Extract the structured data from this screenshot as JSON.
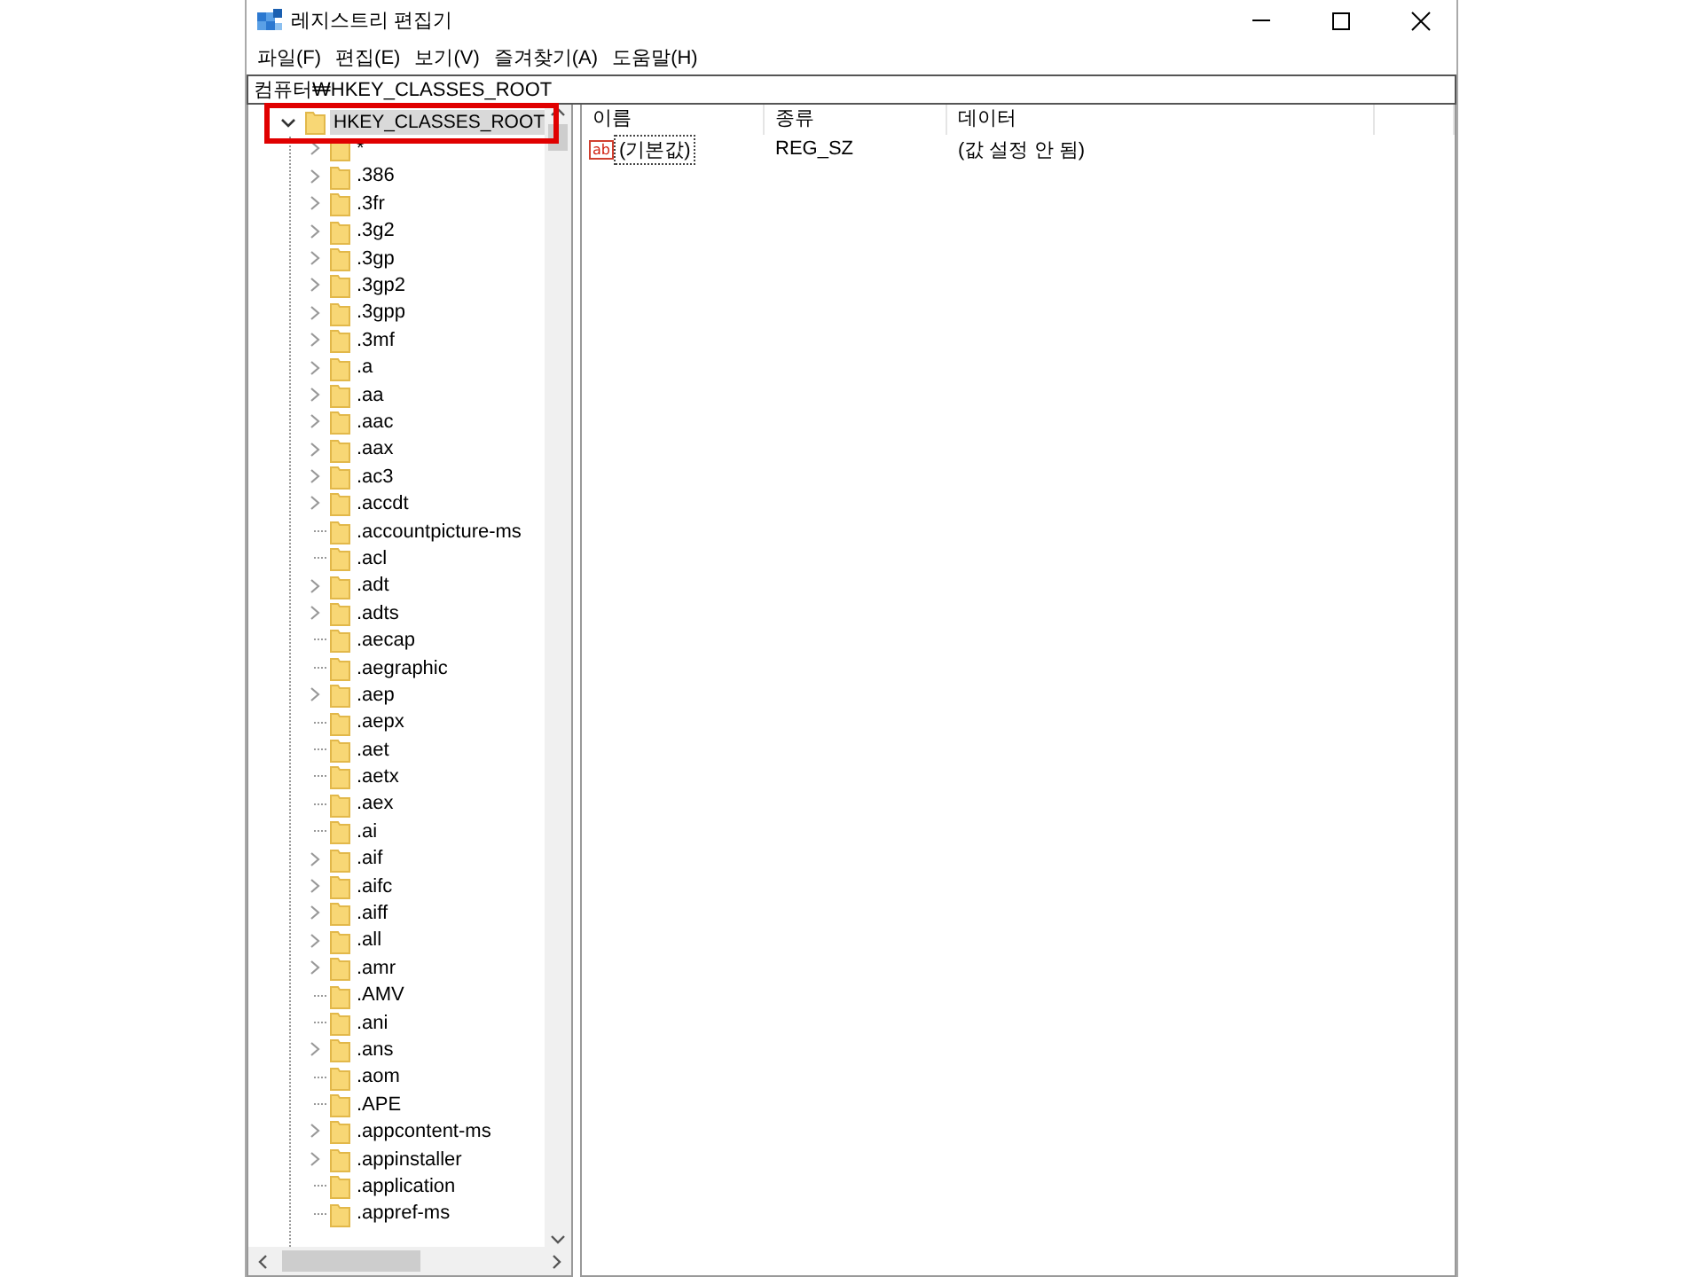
{
  "window": {
    "title": "레지스트리 편집기"
  },
  "menu": [
    "파일(F)",
    "편집(E)",
    "보기(V)",
    "즐겨찾기(A)",
    "도움말(H)"
  ],
  "address": "컴퓨터₩HKEY_CLASSES_ROOT",
  "tree": {
    "label": "HKEY_CLASSES_ROOT",
    "expanded": true,
    "selected": true,
    "outlined": true,
    "children": [
      {
        "label": "*",
        "expandable": true
      },
      {
        "label": ".386",
        "expandable": true
      },
      {
        "label": ".3fr",
        "expandable": true
      },
      {
        "label": ".3g2",
        "expandable": true
      },
      {
        "label": ".3gp",
        "expandable": true
      },
      {
        "label": ".3gp2",
        "expandable": true
      },
      {
        "label": ".3gpp",
        "expandable": true
      },
      {
        "label": ".3mf",
        "expandable": true
      },
      {
        "label": ".a",
        "expandable": true
      },
      {
        "label": ".aa",
        "expandable": true
      },
      {
        "label": ".aac",
        "expandable": true
      },
      {
        "label": ".aax",
        "expandable": true
      },
      {
        "label": ".ac3",
        "expandable": true
      },
      {
        "label": ".accdt",
        "expandable": true
      },
      {
        "label": ".accountpicture-ms",
        "expandable": false
      },
      {
        "label": ".acl",
        "expandable": false
      },
      {
        "label": ".adt",
        "expandable": true
      },
      {
        "label": ".adts",
        "expandable": true
      },
      {
        "label": ".aecap",
        "expandable": false
      },
      {
        "label": ".aegraphic",
        "expandable": false
      },
      {
        "label": ".aep",
        "expandable": true
      },
      {
        "label": ".aepx",
        "expandable": false
      },
      {
        "label": ".aet",
        "expandable": false
      },
      {
        "label": ".aetx",
        "expandable": false
      },
      {
        "label": ".aex",
        "expandable": false
      },
      {
        "label": ".ai",
        "expandable": false
      },
      {
        "label": ".aif",
        "expandable": true
      },
      {
        "label": ".aifc",
        "expandable": true
      },
      {
        "label": ".aiff",
        "expandable": true
      },
      {
        "label": ".all",
        "expandable": true
      },
      {
        "label": ".amr",
        "expandable": true
      },
      {
        "label": ".AMV",
        "expandable": false
      },
      {
        "label": ".ani",
        "expandable": false
      },
      {
        "label": ".ans",
        "expandable": true
      },
      {
        "label": ".aom",
        "expandable": false
      },
      {
        "label": ".APE",
        "expandable": false
      },
      {
        "label": ".appcontent-ms",
        "expandable": true
      },
      {
        "label": ".appinstaller",
        "expandable": true
      },
      {
        "label": ".application",
        "expandable": false
      },
      {
        "label": ".appref-ms",
        "expandable": false
      }
    ]
  },
  "list": {
    "columns": [
      "이름",
      "종류",
      "데이터"
    ],
    "rows": [
      {
        "icon_label": "ab",
        "name": "(기본값)",
        "type": "REG_SZ",
        "data": "(값 설정 안 됨)",
        "focused": true
      }
    ]
  }
}
